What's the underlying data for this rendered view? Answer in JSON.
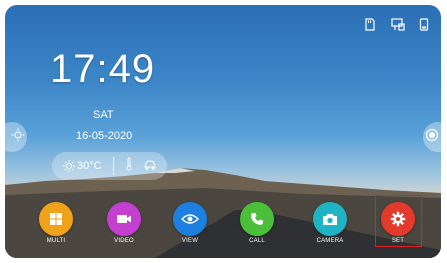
{
  "status_bar": {
    "icons": [
      "sd-card-icon",
      "usb-icon",
      "phone-icon"
    ]
  },
  "clock": {
    "time": "17:49",
    "day": "SAT",
    "date": "16-05-2020"
  },
  "weather": {
    "temperature": "30°C",
    "icons": [
      "sun-icon",
      "thermometer-icon",
      "car-icon"
    ]
  },
  "side_buttons": {
    "left_icon": "brightness-icon",
    "right_icon": "record-icon"
  },
  "apps": [
    {
      "label": "MULTI",
      "icon": "grid-icon",
      "color": "#f0a21a"
    },
    {
      "label": "VIDEO",
      "icon": "video-icon",
      "color": "#c33fd0"
    },
    {
      "label": "VIEW",
      "icon": "eye-icon",
      "color": "#1e7fe0"
    },
    {
      "label": "CALL",
      "icon": "phone-call-icon",
      "color": "#4bbf3a"
    },
    {
      "label": "CAMERA",
      "icon": "camera-icon",
      "color": "#1fb3c4"
    },
    {
      "label": "SET",
      "icon": "gear-icon",
      "color": "#e33a2c"
    }
  ],
  "selected_app": "SET"
}
